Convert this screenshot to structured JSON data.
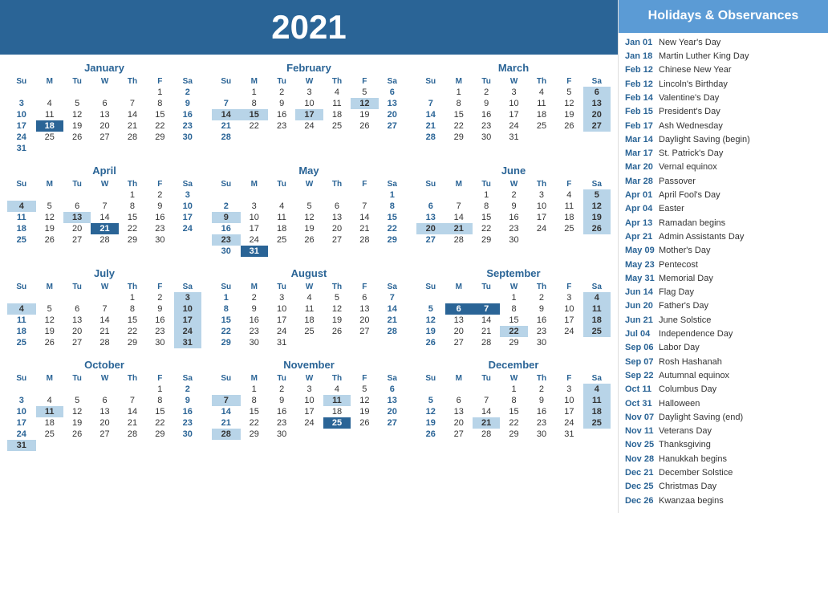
{
  "header": {
    "year": "2021",
    "title": "2021"
  },
  "sidebar": {
    "heading": "Holidays &\nObservances",
    "holidays": [
      {
        "date": "Jan 01",
        "name": "New Year's Day"
      },
      {
        "date": "Jan 18",
        "name": "Martin Luther King Day"
      },
      {
        "date": "Feb 12",
        "name": "Chinese New Year"
      },
      {
        "date": "Feb 12",
        "name": "Lincoln's Birthday"
      },
      {
        "date": "Feb 14",
        "name": "Valentine's Day"
      },
      {
        "date": "Feb 15",
        "name": "President's Day"
      },
      {
        "date": "Feb 17",
        "name": "Ash Wednesday"
      },
      {
        "date": "Mar 14",
        "name": "Daylight Saving (begin)"
      },
      {
        "date": "Mar 17",
        "name": "St. Patrick's Day"
      },
      {
        "date": "Mar 20",
        "name": "Vernal equinox"
      },
      {
        "date": "Mar 28",
        "name": "Passover"
      },
      {
        "date": "Apr 01",
        "name": "April Fool's Day"
      },
      {
        "date": "Apr 04",
        "name": "Easter"
      },
      {
        "date": "Apr 13",
        "name": "Ramadan begins"
      },
      {
        "date": "Apr 21",
        "name": "Admin Assistants Day"
      },
      {
        "date": "May 09",
        "name": "Mother's Day"
      },
      {
        "date": "May 23",
        "name": "Pentecost"
      },
      {
        "date": "May 31",
        "name": "Memorial Day"
      },
      {
        "date": "Jun 14",
        "name": "Flag Day"
      },
      {
        "date": "Jun 20",
        "name": "Father's Day"
      },
      {
        "date": "Jun 21",
        "name": "June Solstice"
      },
      {
        "date": "Jul 04",
        "name": "Independence Day"
      },
      {
        "date": "Sep 06",
        "name": "Labor Day"
      },
      {
        "date": "Sep 07",
        "name": "Rosh Hashanah"
      },
      {
        "date": "Sep 22",
        "name": "Autumnal equinox"
      },
      {
        "date": "Oct 11",
        "name": "Columbus Day"
      },
      {
        "date": "Oct 31",
        "name": "Halloween"
      },
      {
        "date": "Nov 07",
        "name": "Daylight Saving (end)"
      },
      {
        "date": "Nov 11",
        "name": "Veterans Day"
      },
      {
        "date": "Nov 25",
        "name": "Thanksgiving"
      },
      {
        "date": "Nov 28",
        "name": "Hanukkah begins"
      },
      {
        "date": "Dec 21",
        "name": "December Solstice"
      },
      {
        "date": "Dec 25",
        "name": "Christmas Day"
      },
      {
        "date": "Dec 26",
        "name": "Kwanzaa begins"
      }
    ]
  },
  "months": [
    {
      "name": "January",
      "weeks": [
        [
          "",
          "",
          "",
          "",
          "",
          "1",
          "2"
        ],
        [
          "3",
          "4",
          "5",
          "6",
          "7",
          "8",
          "9"
        ],
        [
          "10",
          "11",
          "12",
          "13",
          "14",
          "15",
          "16"
        ],
        [
          "17",
          "18",
          "19",
          "20",
          "21",
          "22",
          "23"
        ],
        [
          "24",
          "25",
          "26",
          "27",
          "28",
          "29",
          "30"
        ],
        [
          "31",
          "",
          "",
          "",
          "",
          "",
          ""
        ]
      ],
      "highlights": {
        "18": "dark"
      }
    },
    {
      "name": "February",
      "weeks": [
        [
          "",
          "1",
          "2",
          "3",
          "4",
          "5",
          "6"
        ],
        [
          "7",
          "8",
          "9",
          "10",
          "11",
          "12",
          "13"
        ],
        [
          "14",
          "15",
          "16",
          "17",
          "18",
          "19",
          "20"
        ],
        [
          "21",
          "22",
          "23",
          "24",
          "25",
          "26",
          "27"
        ],
        [
          "28",
          "",
          "",
          "",
          "",
          "",
          ""
        ]
      ],
      "highlights": {
        "12": "blue",
        "14": "blue",
        "15": "blue",
        "17": "blue"
      }
    },
    {
      "name": "March",
      "weeks": [
        [
          "",
          "1",
          "2",
          "3",
          "4",
          "5",
          "6"
        ],
        [
          "7",
          "8",
          "9",
          "10",
          "11",
          "12",
          "13"
        ],
        [
          "14",
          "15",
          "16",
          "17",
          "18",
          "19",
          "20"
        ],
        [
          "21",
          "22",
          "23",
          "24",
          "25",
          "26",
          "27"
        ],
        [
          "28",
          "29",
          "30",
          "31",
          "",
          "",
          ""
        ]
      ],
      "highlights": {
        "6": "blue",
        "13": "blue",
        "20": "blue",
        "27": "blue"
      }
    },
    {
      "name": "April",
      "weeks": [
        [
          "",
          "",
          "",
          "",
          "1",
          "2",
          "3"
        ],
        [
          "4",
          "5",
          "6",
          "7",
          "8",
          "9",
          "10"
        ],
        [
          "11",
          "12",
          "13",
          "14",
          "15",
          "16",
          "17"
        ],
        [
          "18",
          "19",
          "20",
          "21",
          "22",
          "23",
          "24"
        ],
        [
          "25",
          "26",
          "27",
          "28",
          "29",
          "30",
          ""
        ]
      ],
      "highlights": {
        "4": "blue",
        "13": "blue",
        "21": "dark"
      }
    },
    {
      "name": "May",
      "weeks": [
        [
          "",
          "",
          "",
          "",
          "",
          "",
          "1"
        ],
        [
          "2",
          "3",
          "4",
          "5",
          "6",
          "7",
          "8"
        ],
        [
          "9",
          "10",
          "11",
          "12",
          "13",
          "14",
          "15"
        ],
        [
          "16",
          "17",
          "18",
          "19",
          "20",
          "21",
          "22"
        ],
        [
          "23",
          "24",
          "25",
          "26",
          "27",
          "28",
          "29"
        ],
        [
          "30",
          "31",
          "",
          "",
          "",
          "",
          ""
        ]
      ],
      "highlights": {
        "9": "blue",
        "23": "blue",
        "31": "dark"
      }
    },
    {
      "name": "June",
      "weeks": [
        [
          "",
          "",
          "1",
          "2",
          "3",
          "4",
          "5"
        ],
        [
          "6",
          "7",
          "8",
          "9",
          "10",
          "11",
          "12"
        ],
        [
          "13",
          "14",
          "15",
          "16",
          "17",
          "18",
          "19"
        ],
        [
          "20",
          "21",
          "22",
          "23",
          "24",
          "25",
          "26"
        ],
        [
          "27",
          "28",
          "29",
          "30",
          "",
          "",
          ""
        ]
      ],
      "highlights": {
        "5": "blue",
        "12": "blue",
        "19": "blue",
        "20": "blue",
        "21": "blue",
        "26": "blue"
      }
    },
    {
      "name": "July",
      "weeks": [
        [
          "",
          "",
          "",
          "",
          "1",
          "2",
          "3"
        ],
        [
          "4",
          "5",
          "6",
          "7",
          "8",
          "9",
          "10"
        ],
        [
          "11",
          "12",
          "13",
          "14",
          "15",
          "16",
          "17"
        ],
        [
          "18",
          "19",
          "20",
          "21",
          "22",
          "23",
          "24"
        ],
        [
          "25",
          "26",
          "27",
          "28",
          "29",
          "30",
          "31"
        ]
      ],
      "highlights": {
        "4": "blue",
        "3": "blue",
        "10": "blue",
        "17": "blue",
        "24": "blue",
        "31": "blue"
      }
    },
    {
      "name": "August",
      "weeks": [
        [
          "1",
          "2",
          "3",
          "4",
          "5",
          "6",
          "7"
        ],
        [
          "8",
          "9",
          "10",
          "11",
          "12",
          "13",
          "14"
        ],
        [
          "15",
          "16",
          "17",
          "18",
          "19",
          "20",
          "21"
        ],
        [
          "22",
          "23",
          "24",
          "25",
          "26",
          "27",
          "28"
        ],
        [
          "29",
          "30",
          "31",
          "",
          "",
          "",
          ""
        ]
      ],
      "highlights": {}
    },
    {
      "name": "September",
      "weeks": [
        [
          "",
          "",
          "",
          "1",
          "2",
          "3",
          "4"
        ],
        [
          "5",
          "6",
          "7",
          "8",
          "9",
          "10",
          "11"
        ],
        [
          "12",
          "13",
          "14",
          "15",
          "16",
          "17",
          "18"
        ],
        [
          "19",
          "20",
          "21",
          "22",
          "23",
          "24",
          "25"
        ],
        [
          "26",
          "27",
          "28",
          "29",
          "30",
          "",
          ""
        ]
      ],
      "highlights": {
        "4": "blue",
        "6": "dark",
        "7": "dark",
        "11": "blue",
        "18": "blue",
        "22": "blue",
        "25": "blue"
      }
    },
    {
      "name": "October",
      "weeks": [
        [
          "",
          "",
          "",
          "",
          "",
          "1",
          "2"
        ],
        [
          "3",
          "4",
          "5",
          "6",
          "7",
          "8",
          "9"
        ],
        [
          "10",
          "11",
          "12",
          "13",
          "14",
          "15",
          "16"
        ],
        [
          "17",
          "18",
          "19",
          "20",
          "21",
          "22",
          "23"
        ],
        [
          "24",
          "25",
          "26",
          "27",
          "28",
          "29",
          "30"
        ],
        [
          "31",
          "",
          "",
          "",
          "",
          "",
          ""
        ]
      ],
      "highlights": {
        "11": "blue",
        "31": "blue"
      }
    },
    {
      "name": "November",
      "weeks": [
        [
          "",
          "1",
          "2",
          "3",
          "4",
          "5",
          "6"
        ],
        [
          "7",
          "8",
          "9",
          "10",
          "11",
          "12",
          "13"
        ],
        [
          "14",
          "15",
          "16",
          "17",
          "18",
          "19",
          "20"
        ],
        [
          "21",
          "22",
          "23",
          "24",
          "25",
          "26",
          "27"
        ],
        [
          "28",
          "29",
          "30",
          "",
          "",
          "",
          ""
        ]
      ],
      "highlights": {
        "7": "blue",
        "11": "blue",
        "25": "dark",
        "28": "blue"
      }
    },
    {
      "name": "December",
      "weeks": [
        [
          "",
          "",
          "",
          "1",
          "2",
          "3",
          "4"
        ],
        [
          "5",
          "6",
          "7",
          "8",
          "9",
          "10",
          "11"
        ],
        [
          "12",
          "13",
          "14",
          "15",
          "16",
          "17",
          "18"
        ],
        [
          "19",
          "20",
          "21",
          "22",
          "23",
          "24",
          "25"
        ],
        [
          "26",
          "27",
          "28",
          "29",
          "30",
          "31",
          ""
        ]
      ],
      "highlights": {
        "4": "blue",
        "11": "blue",
        "18": "blue",
        "21": "blue",
        "25": "blue"
      }
    }
  ]
}
